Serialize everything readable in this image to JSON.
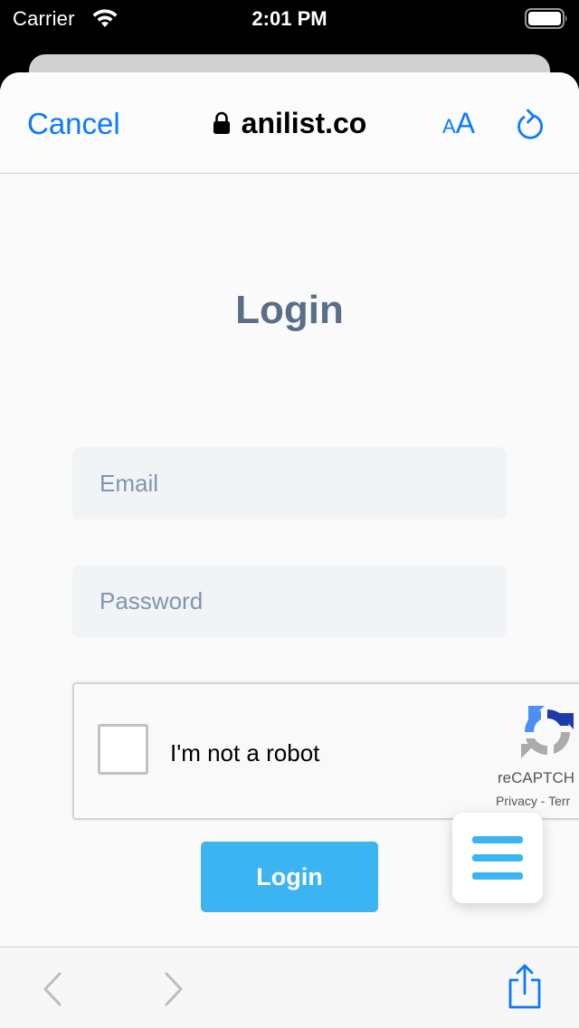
{
  "status_bar": {
    "carrier": "Carrier",
    "time": "2:01 PM"
  },
  "browser": {
    "cancel_label": "Cancel",
    "address": "anilist.co",
    "text_size_small": "A",
    "text_size_large": "A",
    "accent_color": "#0a7aff"
  },
  "page": {
    "title": "Login",
    "email_placeholder": "Email",
    "password_placeholder": "Password",
    "login_label": "Login",
    "button_color": "#3db4f2"
  },
  "captcha": {
    "label": "I'm not a robot",
    "brand": "reCAPTCH",
    "links": "Privacy - Terr"
  },
  "icons": [
    "wifi-icon",
    "battery-icon",
    "lock-icon",
    "reload-icon",
    "recaptcha-logo-icon",
    "menu-icon",
    "back-arrow-icon",
    "forward-arrow-icon",
    "share-icon"
  ]
}
